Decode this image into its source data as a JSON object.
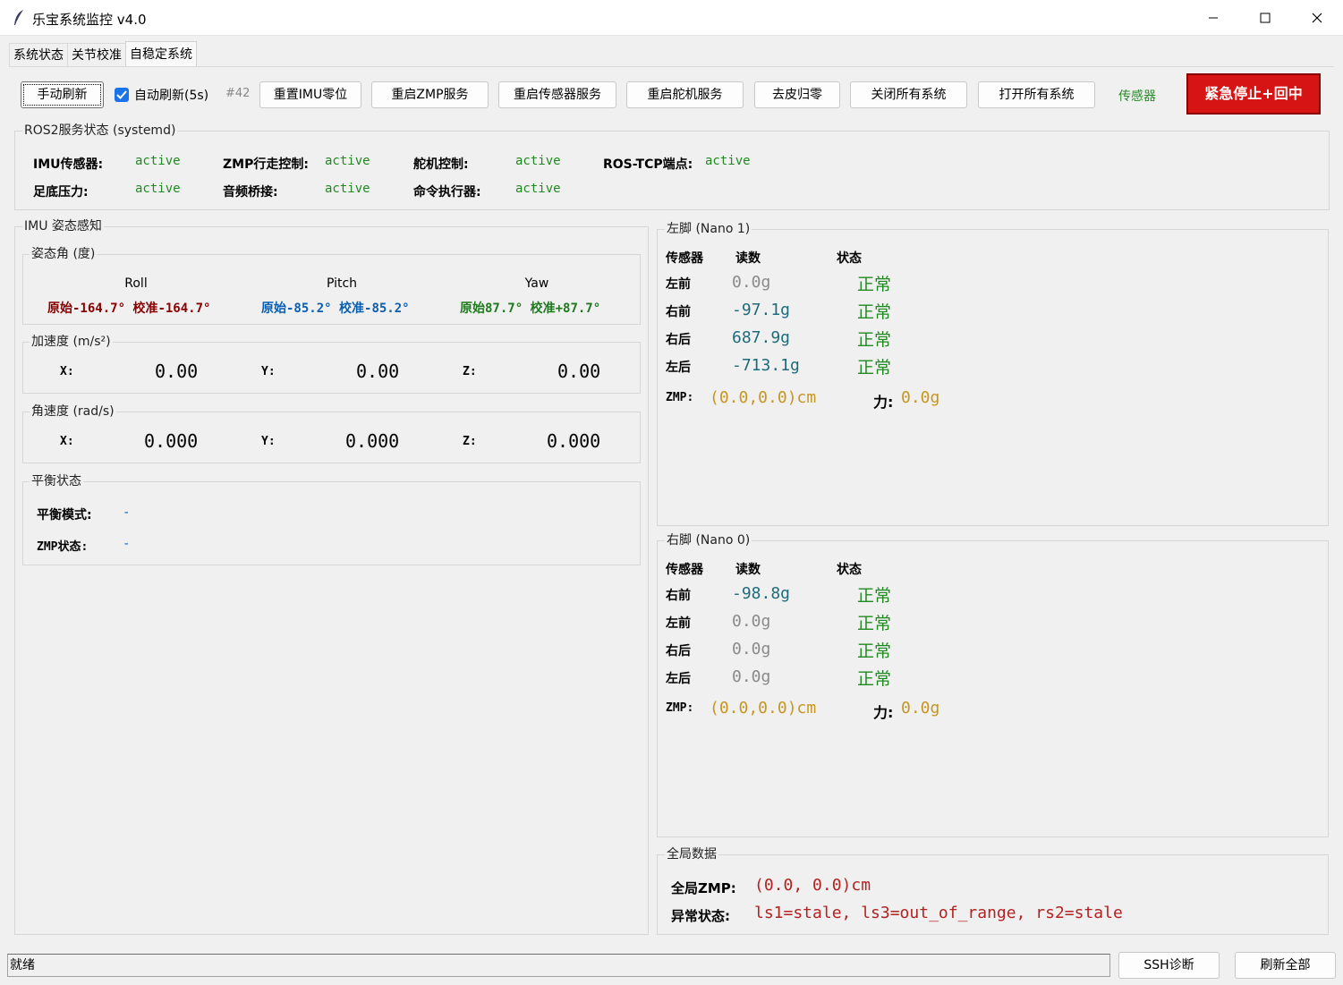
{
  "window": {
    "title": "乐宝系统监控 v4.0"
  },
  "tabs": [
    {
      "label": "系统状态"
    },
    {
      "label": "关节校准"
    },
    {
      "label": "自稳定系统"
    }
  ],
  "toolbar": {
    "manual_refresh": "手动刷新",
    "auto_refresh": "自动刷新(5s)",
    "counter": "#42",
    "reset_imu": "重置IMU零位",
    "restart_zmp": "重启ZMP服务",
    "restart_sensor": "重启传感器服务",
    "restart_servo": "重启舵机服务",
    "tare": "去皮归零",
    "close_all": "关闭所有系统",
    "open_all": "打开所有系统",
    "sensor_tag": "传感器",
    "estop": "紧急停止+回中"
  },
  "ros2": {
    "title": "ROS2服务状态 (systemd)",
    "services": [
      {
        "label": "IMU传感器:",
        "status": "active"
      },
      {
        "label": "ZMP行走控制:",
        "status": "active"
      },
      {
        "label": "舵机控制:",
        "status": "active"
      },
      {
        "label": "ROS-TCP端点:",
        "status": "active"
      },
      {
        "label": "足底压力:",
        "status": "active"
      },
      {
        "label": "音频桥接:",
        "status": "active"
      },
      {
        "label": "命令执行器:",
        "status": "active"
      }
    ]
  },
  "imu": {
    "title": "IMU 姿态感知",
    "attitude": {
      "title": "姿态角 (度)",
      "roll": {
        "name": "Roll",
        "raw_label": "原始",
        "raw": "-164.7°",
        "cal_label": "校准",
        "cal": "-164.7°"
      },
      "pitch": {
        "name": "Pitch",
        "raw_label": "原始",
        "raw": "-85.2°",
        "cal_label": "校准",
        "cal": "-85.2°"
      },
      "yaw": {
        "name": "Yaw",
        "raw_label": "原始",
        "raw": "87.7°",
        "cal_label": "校准",
        "cal": "+87.7°"
      }
    },
    "accel": {
      "title": "加速度 (m/s²)",
      "x_label": "X:",
      "x": "0.00",
      "y_label": "Y:",
      "y": "0.00",
      "z_label": "Z:",
      "z": "0.00"
    },
    "gyro": {
      "title": "角速度 (rad/s)",
      "x_label": "X:",
      "x": "0.000",
      "y_label": "Y:",
      "y": "0.000",
      "z_label": "Z:",
      "z": "0.000"
    },
    "balance": {
      "title": "平衡状态",
      "mode_label": "平衡模式:",
      "mode": "-",
      "zmp_label": "ZMP状态:",
      "zmp": "-"
    }
  },
  "colors": {
    "roll": "#8b0000",
    "pitch": "#0b5fb0",
    "yaw": "#1f7a1f",
    "active": "#1f8a1f",
    "gold": "#c8961e",
    "teal": "#1e6b7a",
    "gray": "#8a8a8a",
    "red": "#b22222",
    "estop": "#d61414"
  },
  "left_foot": {
    "title": "左脚 (Nano 1)",
    "headers": {
      "sensor": "传感器",
      "reading": "读数",
      "status": "状态"
    },
    "rows": [
      {
        "name": "左前",
        "reading": "0.0g",
        "status": "正常",
        "tone": "gray"
      },
      {
        "name": "右前",
        "reading": "-97.1g",
        "status": "正常",
        "tone": "teal"
      },
      {
        "name": "右后",
        "reading": "687.9g",
        "status": "正常",
        "tone": "teal"
      },
      {
        "name": "左后",
        "reading": "-713.1g",
        "status": "正常",
        "tone": "teal"
      }
    ],
    "zmp_label": "ZMP:",
    "zmp": "(0.0,0.0)cm",
    "force_label": "力:",
    "force": "0.0g"
  },
  "right_foot": {
    "title": "右脚 (Nano 0)",
    "headers": {
      "sensor": "传感器",
      "reading": "读数",
      "status": "状态"
    },
    "rows": [
      {
        "name": "右前",
        "reading": "-98.8g",
        "status": "正常",
        "tone": "teal"
      },
      {
        "name": "左前",
        "reading": "0.0g",
        "status": "正常",
        "tone": "gray"
      },
      {
        "name": "右后",
        "reading": "0.0g",
        "status": "正常",
        "tone": "gray"
      },
      {
        "name": "左后",
        "reading": "0.0g",
        "status": "正常",
        "tone": "gray"
      }
    ],
    "zmp_label": "ZMP:",
    "zmp": "(0.0,0.0)cm",
    "force_label": "力:",
    "force": "0.0g"
  },
  "global": {
    "title": "全局数据",
    "zmp_label": "全局ZMP:",
    "zmp": "(0.0, 0.0)cm",
    "anomaly_label": "异常状态:",
    "anomaly": "ls1=stale, ls3=out_of_range, rs2=stale"
  },
  "statusbar": {
    "text": "就绪",
    "ssh": "SSH诊断",
    "refresh_all": "刷新全部"
  }
}
